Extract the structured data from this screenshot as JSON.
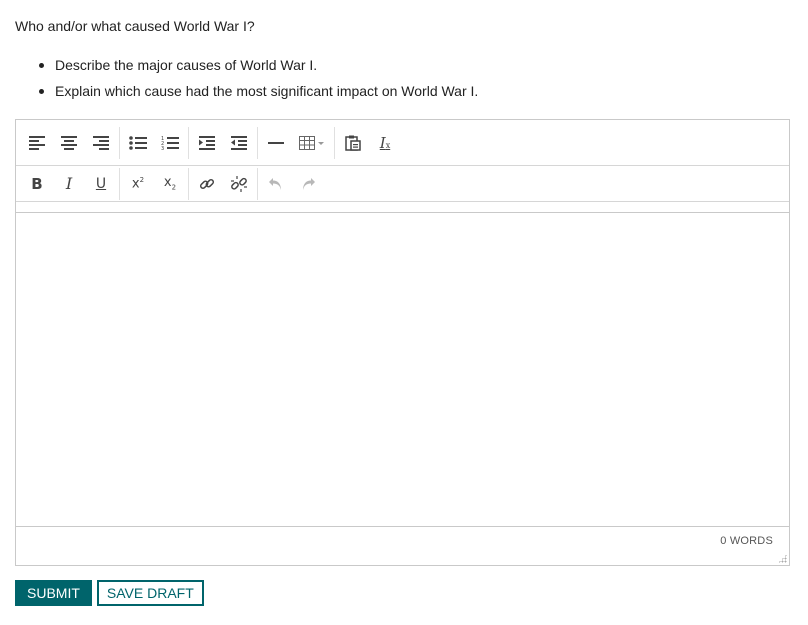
{
  "question": {
    "prompt": "Who and/or what caused World War I?",
    "bullets": [
      "Describe the major causes of World War I.",
      "Explain which cause had the most significant impact on World War I."
    ]
  },
  "editor": {
    "toolbar_row1": [
      {
        "icon": "align-left-icon"
      },
      {
        "icon": "align-center-icon"
      },
      {
        "icon": "align-right-icon"
      },
      {
        "icon": "bulleted-list-icon"
      },
      {
        "icon": "numbered-list-icon"
      },
      {
        "icon": "indent-icon"
      },
      {
        "icon": "outdent-icon"
      },
      {
        "icon": "horizontal-rule-icon"
      },
      {
        "icon": "table-icon"
      },
      {
        "icon": "paste-icon"
      },
      {
        "icon": "clear-formatting-icon"
      }
    ],
    "toolbar_row2": {
      "bold": "B",
      "italic": "I",
      "underline": "U",
      "superscript": "x",
      "subscript": "x",
      "link_icon": "link-icon",
      "unlink_icon": "unlink-icon",
      "undo_icon": "undo-icon",
      "redo_icon": "redo-icon"
    },
    "content": "",
    "word_count": "0 WORDS"
  },
  "actions": {
    "submit_label": "SUBMIT",
    "save_draft_label": "SAVE DRAFT"
  },
  "colors": {
    "accent": "#00646b",
    "border": "#c9c9c9",
    "icon": "#444444",
    "icon_disabled": "#b8b8b8"
  }
}
